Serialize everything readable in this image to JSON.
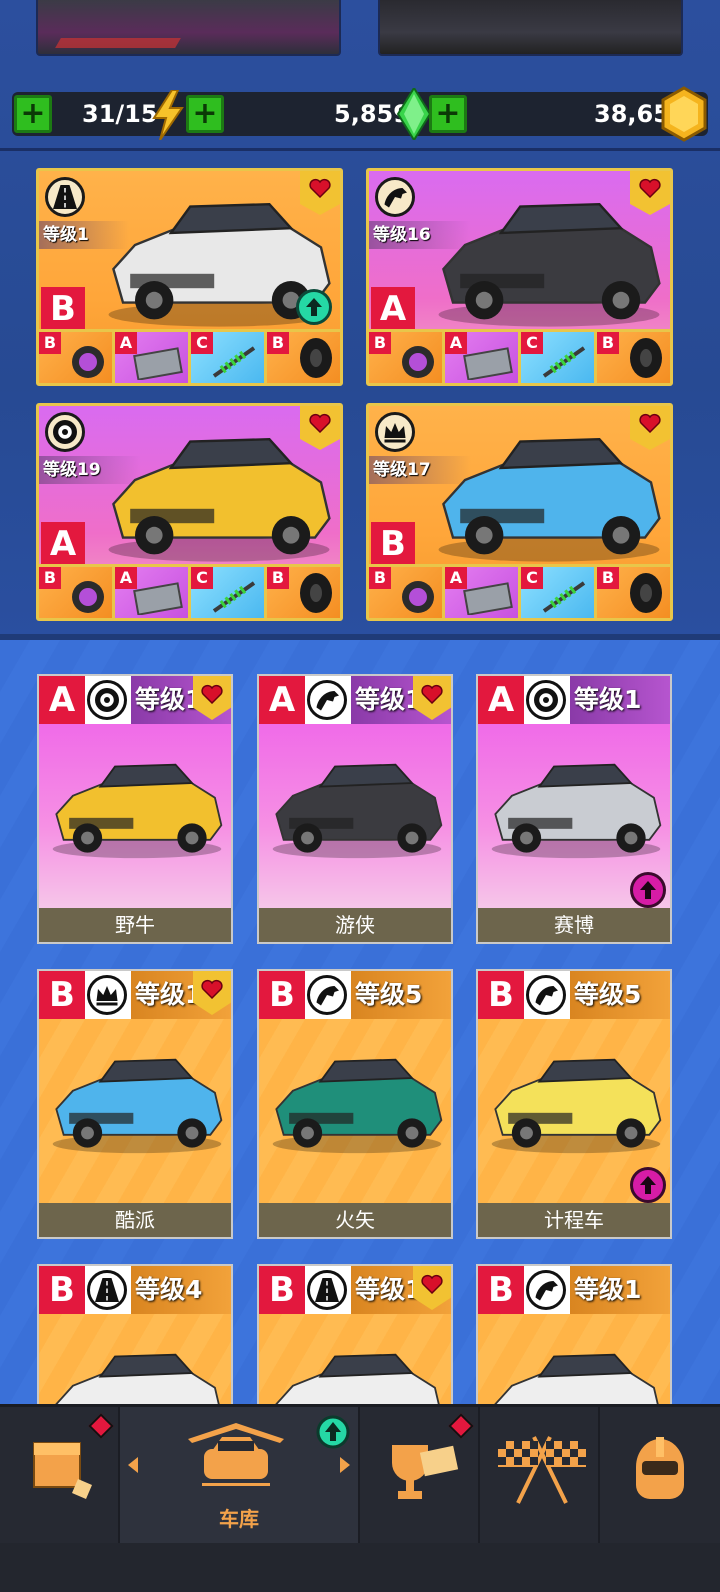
{
  "resources": {
    "energy": "31/15",
    "gems": "5,859",
    "coins": "38,655",
    "plus": "+"
  },
  "team": [
    {
      "level": "等级1",
      "rank": "B",
      "bg": "orange",
      "class_icon": "road-icon",
      "car_color": "#e8e8e8",
      "upgrade": true,
      "parts": [
        {
          "g": "B",
          "type": "turbo-icon",
          "bg": "po"
        },
        {
          "g": "A",
          "type": "engine-icon",
          "bg": "pp"
        },
        {
          "g": "C",
          "type": "suspension-icon",
          "bg": "pb"
        },
        {
          "g": "B",
          "type": "tire-icon",
          "bg": "po"
        }
      ]
    },
    {
      "level": "等级16",
      "rank": "A",
      "bg": "purple",
      "class_icon": "horse-icon",
      "car_color": "#3b3b40",
      "upgrade": false,
      "parts": [
        {
          "g": "B",
          "type": "turbo-icon",
          "bg": "po"
        },
        {
          "g": "A",
          "type": "engine-icon",
          "bg": "pp"
        },
        {
          "g": "C",
          "type": "suspension-icon",
          "bg": "pb"
        },
        {
          "g": "B",
          "type": "tire-icon",
          "bg": "po"
        }
      ]
    },
    {
      "level": "等级19",
      "rank": "A",
      "bg": "purple",
      "class_icon": "tire-class-icon",
      "car_color": "#f2c02e",
      "upgrade": false,
      "parts": [
        {
          "g": "B",
          "type": "turbo-icon",
          "bg": "po"
        },
        {
          "g": "A",
          "type": "engine-icon",
          "bg": "pp"
        },
        {
          "g": "C",
          "type": "suspension-icon",
          "bg": "pb"
        },
        {
          "g": "B",
          "type": "tire-icon",
          "bg": "po"
        }
      ]
    },
    {
      "level": "等级17",
      "rank": "B",
      "bg": "orange",
      "class_icon": "crown-icon",
      "car_color": "#4fb4ec",
      "upgrade": false,
      "parts": [
        {
          "g": "B",
          "type": "turbo-icon",
          "bg": "po"
        },
        {
          "g": "A",
          "type": "engine-icon",
          "bg": "pp"
        },
        {
          "g": "C",
          "type": "suspension-icon",
          "bg": "pb"
        },
        {
          "g": "B",
          "type": "tire-icon",
          "bg": "po"
        }
      ]
    }
  ],
  "garage": [
    {
      "rank": "A",
      "level": "等级1",
      "name": "野牛",
      "bg": "purple",
      "class_icon": "tire-class-icon",
      "heart": true,
      "up": false,
      "car_color": "#f2c02e"
    },
    {
      "rank": "A",
      "level": "等级1",
      "name": "游侠",
      "bg": "purple",
      "class_icon": "horse-icon",
      "heart": true,
      "up": false,
      "car_color": "#3b3b40"
    },
    {
      "rank": "A",
      "level": "等级1",
      "name": "赛博",
      "bg": "purple",
      "class_icon": "tire-class-icon",
      "heart": false,
      "up": true,
      "car_color": "#c9ccd2"
    },
    {
      "rank": "B",
      "level": "等级1",
      "name": "酷派",
      "bg": "orange",
      "class_icon": "crown-icon",
      "heart": true,
      "up": false,
      "car_color": "#4fb4ec"
    },
    {
      "rank": "B",
      "level": "等级5",
      "name": "火矢",
      "bg": "orange",
      "class_icon": "horse-icon",
      "heart": false,
      "up": false,
      "car_color": "#1f8f7a"
    },
    {
      "rank": "B",
      "level": "等级5",
      "name": "计程车",
      "bg": "orange",
      "class_icon": "horse-icon",
      "heart": false,
      "up": true,
      "car_color": "#f4e15a"
    },
    {
      "rank": "B",
      "level": "等级4",
      "name": "",
      "bg": "orange",
      "class_icon": "road-icon",
      "heart": false,
      "up": false,
      "car_color": "#eeeeee"
    },
    {
      "rank": "B",
      "level": "等级1",
      "name": "",
      "bg": "orange",
      "class_icon": "road-icon",
      "heart": true,
      "up": false,
      "car_color": "#eeeeee"
    },
    {
      "rank": "B",
      "level": "等级1",
      "name": "",
      "bg": "orange",
      "class_icon": "horse-icon",
      "heart": false,
      "up": false,
      "car_color": "#eeeeee"
    }
  ],
  "nav": {
    "garage_label": "车库"
  }
}
